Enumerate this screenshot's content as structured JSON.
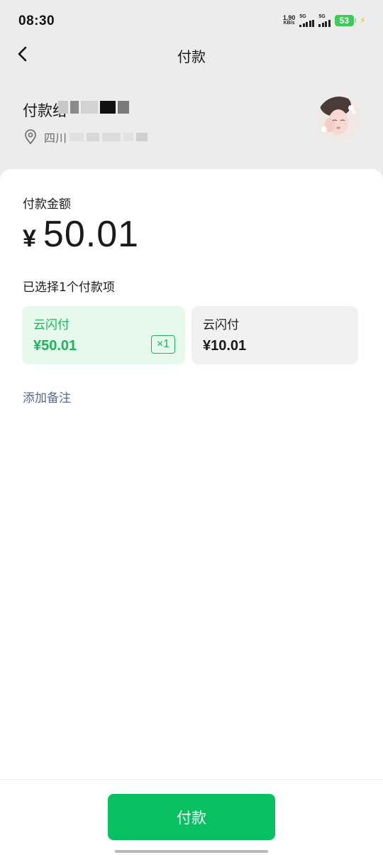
{
  "status_bar": {
    "time": "08:30",
    "net_speed_value": "1.90",
    "net_speed_unit": "KB/s",
    "sim1_label": "5G",
    "sim2_label": "5G",
    "battery_percent": "53",
    "battery_color": "#3ecb5a"
  },
  "nav": {
    "title": "付款",
    "back_icon": "chevron-left-icon"
  },
  "merchant": {
    "name_visible": "付款给",
    "location_visible": "四川",
    "location_icon": "location-pin-icon"
  },
  "payment": {
    "amount_label": "付款金额",
    "currency_symbol": "¥",
    "amount": "50.01",
    "selected_hint": "已选择1个付款项",
    "options": [
      {
        "name": "云闪付",
        "price": "¥50.01",
        "selected": true,
        "quantity": "×1"
      },
      {
        "name": "云闪付",
        "price": "¥10.01",
        "selected": false
      }
    ],
    "add_note_label": "添加备注"
  },
  "footer": {
    "pay_button_label": "付款"
  },
  "colors": {
    "accent_green": "#07c160",
    "selected_text_green": "#18b65a",
    "link_blue": "#576b95",
    "header_bg": "#ececec"
  }
}
